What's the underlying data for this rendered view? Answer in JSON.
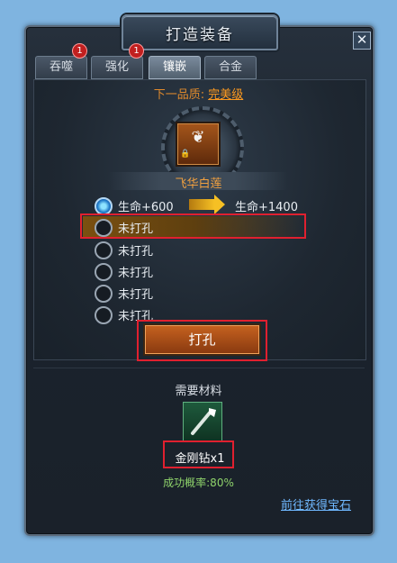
{
  "window": {
    "title": "打造装备",
    "close_icon": "close-icon"
  },
  "tabs": [
    {
      "label": "吞噬",
      "active": false,
      "badge": ""
    },
    {
      "label": "强化",
      "active": false,
      "badge": "1"
    },
    {
      "label": "镶嵌",
      "active": true,
      "badge": "1"
    },
    {
      "label": "合金",
      "active": false,
      "badge": ""
    }
  ],
  "quality": {
    "prefix": "下一品质:",
    "value": "完美级"
  },
  "item": {
    "name": "飞华白莲",
    "icon": "wings-icon"
  },
  "slots": [
    {
      "label": "生命+600",
      "next": "生命+1400",
      "state": "filled"
    },
    {
      "label": "未打孔",
      "state": "empty",
      "highlighted": true
    },
    {
      "label": "未打孔",
      "state": "empty"
    },
    {
      "label": "未打孔",
      "state": "empty"
    },
    {
      "label": "未打孔",
      "state": "empty"
    },
    {
      "label": "未打孔",
      "state": "empty"
    }
  ],
  "punch_button": "打孔",
  "materials": {
    "label": "需要材料",
    "name": "金刚钻x1",
    "icon": "diamond-drill-icon"
  },
  "success_rate": "成功概率:80%",
  "get_gems_link": "前往获得宝石",
  "colors": {
    "accent_orange": "#e08a2c",
    "highlight_red": "#e0202f",
    "link_blue": "#6fb8ff",
    "rate_green": "#8fd36b"
  }
}
